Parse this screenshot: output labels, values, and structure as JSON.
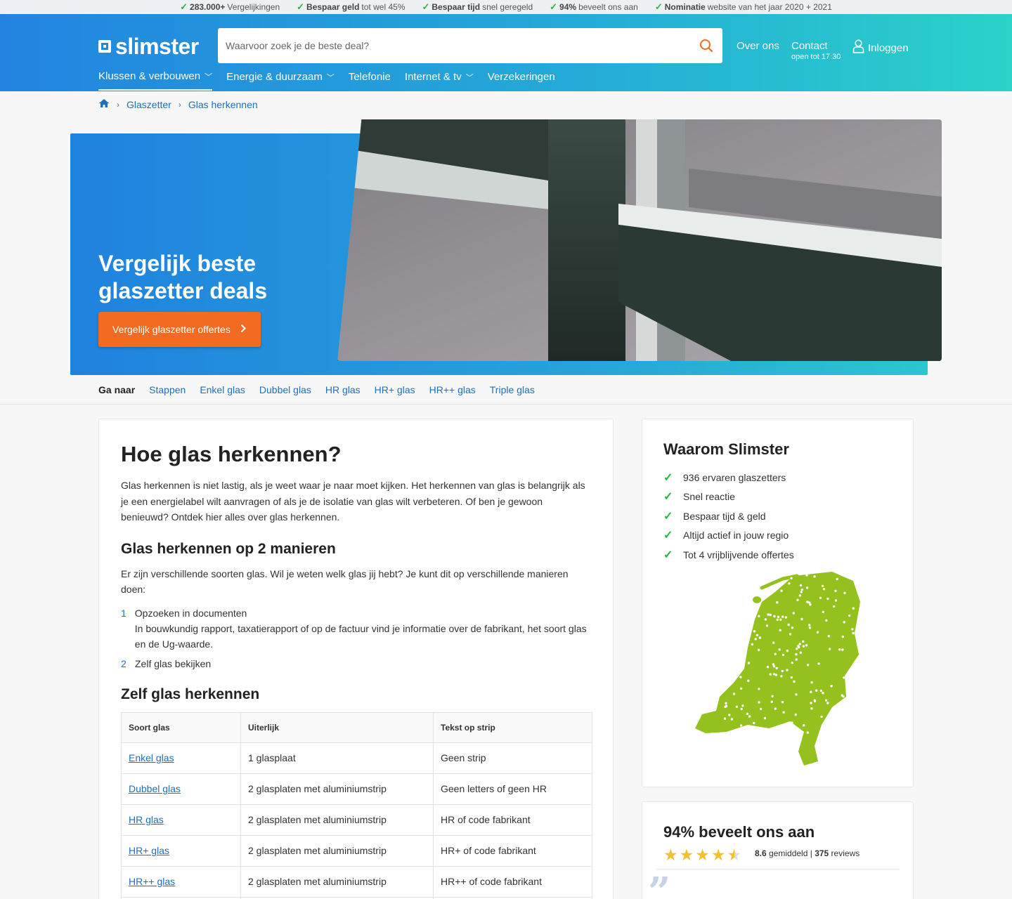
{
  "usp": [
    {
      "bold": "283.000+",
      "text": " Vergelijkingen"
    },
    {
      "bold": "Bespaar geld",
      "text": " tot wel 45%"
    },
    {
      "bold": "Bespaar tijd",
      "text": " snel geregeld"
    },
    {
      "bold": "94%",
      "text": " beveelt ons aan"
    },
    {
      "bold": "Nominatie",
      "text": " website van het jaar 2020 + 2021"
    }
  ],
  "header": {
    "logo": "slimster",
    "search_placeholder": "Waarvoor zoek je de beste deal?",
    "about": "Over ons",
    "contact": "Contact",
    "contact_sub": "open tot 17:30",
    "login": "Inloggen"
  },
  "mainnav": [
    {
      "label": "Klussen & verbouwen",
      "dropdown": true
    },
    {
      "label": "Energie & duurzaam",
      "dropdown": true
    },
    {
      "label": "Telefonie",
      "dropdown": false
    },
    {
      "label": "Internet & tv",
      "dropdown": true
    },
    {
      "label": "Verzekeringen",
      "dropdown": false
    }
  ],
  "breadcrumb": {
    "level1": "Glaszetter",
    "level2": "Glas herkennen"
  },
  "hero": {
    "title": "Vergelijk beste glaszetter deals",
    "button": "Vergelijk glaszetter offertes"
  },
  "goto": {
    "label": "Ga naar",
    "links": [
      "Stappen",
      "Enkel glas",
      "Dubbel glas",
      "HR glas",
      "HR+ glas",
      "HR++ glas",
      "Triple glas"
    ]
  },
  "article": {
    "title": "Hoe glas herkennen?",
    "intro": "Glas herkennen is niet lastig, als je weet waar je naar moet kijken. Het herkennen van glas is belangrijk als je een energielabel wilt aanvragen of als je de isolatie van glas wilt verbeteren. Of ben je gewoon benieuwd? Ontdek hier alles over glas herkennen.",
    "h2_ways": "Glas herkennen op 2 manieren",
    "ways_intro": "Er zijn verschillende soorten glas. Wil je weten welk glas jij hebt? Je kunt dit op verschillende manieren doen:",
    "steps": [
      {
        "num": "1",
        "title": "Opzoeken in documenten",
        "desc": "In bouwkundig rapport, taxatierapport of op de factuur vind je informatie over de fabrikant, het soort glas en de Ug-waarde."
      },
      {
        "num": "2",
        "title": "Zelf glas bekijken",
        "desc": ""
      }
    ],
    "h2_self": "Zelf glas herkennen",
    "table": {
      "headers": [
        "Soort glas",
        "Uiterlijk",
        "Tekst op strip"
      ],
      "rows": [
        [
          "Enkel glas",
          "1 glasplaat",
          "Geen strip"
        ],
        [
          "Dubbel glas",
          "2 glasplaten met aluminiumstrip",
          "Geen letters of geen HR"
        ],
        [
          "HR glas",
          "2 glasplaten met aluminiumstrip",
          "HR of code fabrikant"
        ],
        [
          "HR+ glas",
          "2 glasplaten met aluminiumstrip",
          "HR+ of code fabrikant"
        ],
        [
          "HR++ glas",
          "2 glasplaten met aluminiumstrip",
          "HR++ of code fabrikant"
        ]
      ]
    }
  },
  "why": {
    "title": "Waarom Slimster",
    "items": [
      "936 ervaren glaszetters",
      "Snel reactie",
      "Bespaar tijd & geld",
      "Altijd actief in jouw regio",
      "Tot 4 vrijblijvende offertes"
    ]
  },
  "reviews": {
    "title": "94% beveelt ons aan",
    "score": "8.6",
    "score_label": " gemiddeld | ",
    "count": "375",
    "count_label": " reviews",
    "rating_out_of_5": 4.5
  },
  "colors": {
    "accent": "#f36a21",
    "link": "#1f6fbf",
    "check": "#2db33f",
    "map": "#95c11f"
  }
}
